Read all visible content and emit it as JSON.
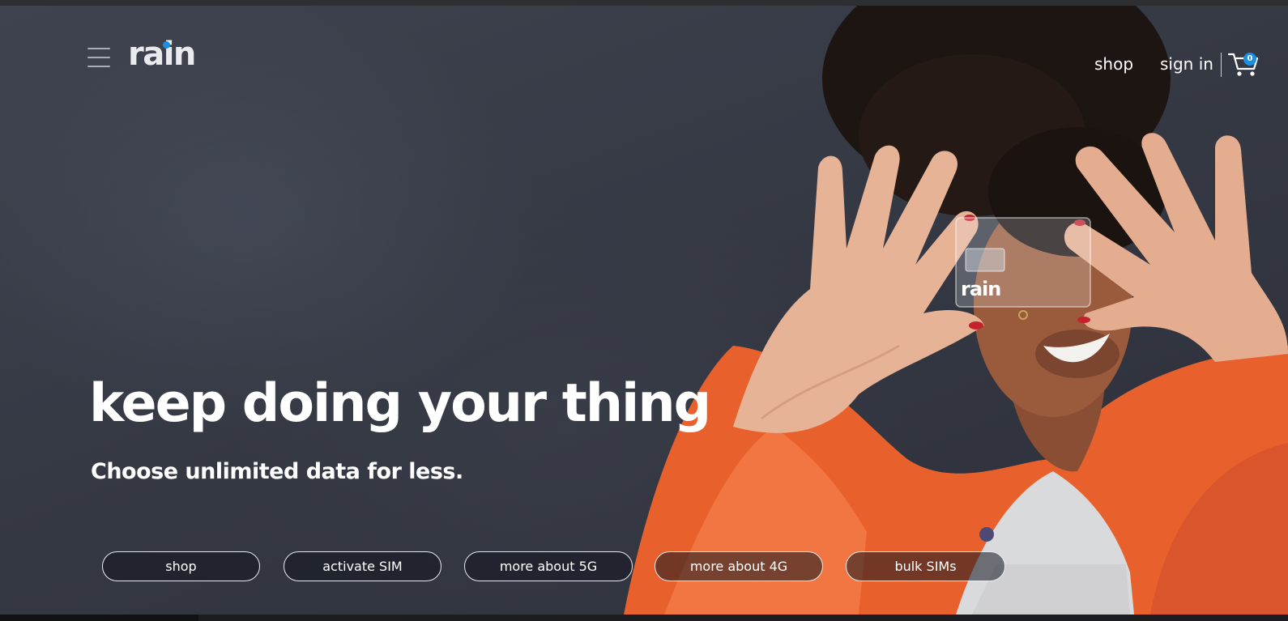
{
  "header": {
    "logo_text": "rain",
    "brand_color": "#1d8fe0",
    "menu_icon": "hamburger-menu-icon",
    "nav": {
      "shop_label": "shop",
      "signin_label": "sign in"
    },
    "cart": {
      "icon": "shopping-cart-icon",
      "count": "0"
    }
  },
  "hero": {
    "headline": "keep doing your thing",
    "subline": "Choose unlimited data for less.",
    "sim_card_text": "rain",
    "accent_orange": "#f06a35"
  },
  "actions": [
    {
      "label": "shop"
    },
    {
      "label": "activate SIM"
    },
    {
      "label": "more about 5G"
    },
    {
      "label": "more about 4G"
    },
    {
      "label": "bulk SIMs"
    }
  ]
}
